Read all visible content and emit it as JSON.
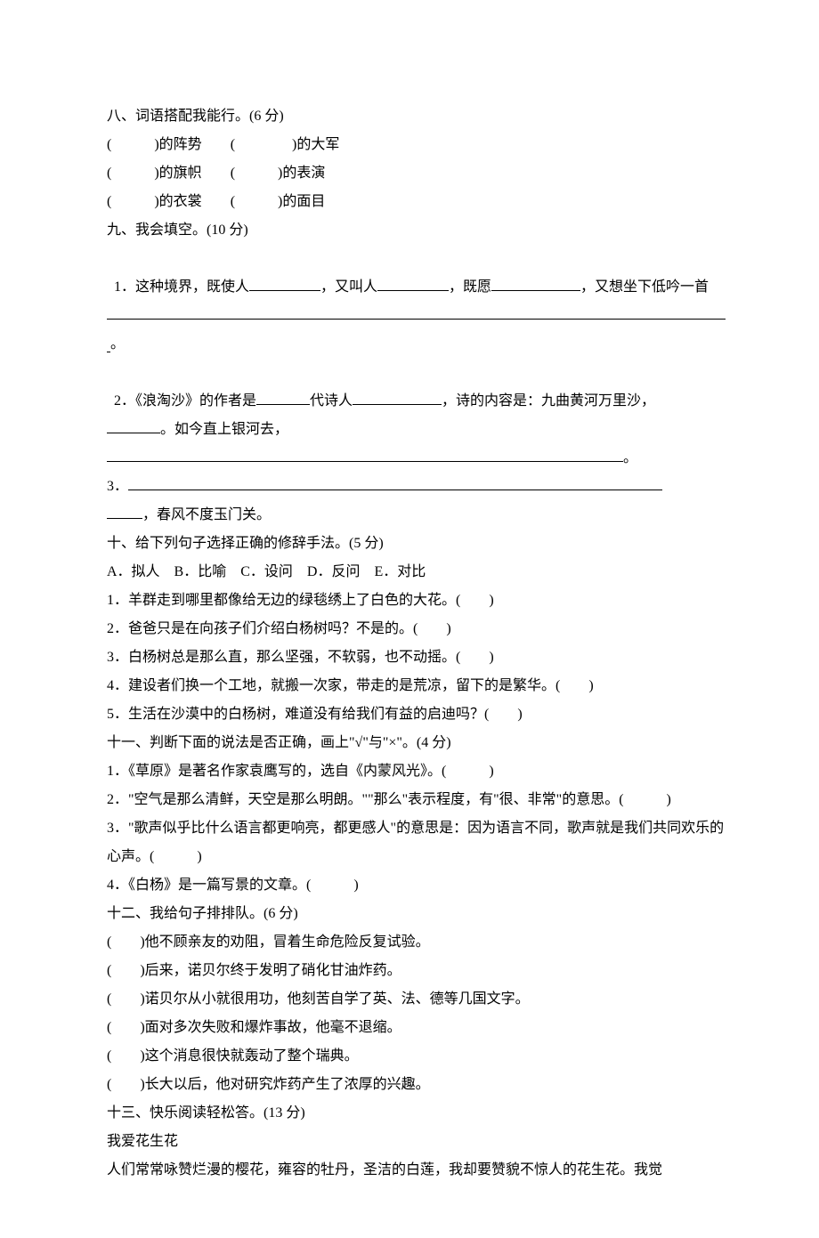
{
  "q8": {
    "title": "八、词语搭配我能行。(6 分)",
    "rows": [
      {
        "a": "(　　　)的阵势",
        "b": "(　　　　)的大军"
      },
      {
        "a": "(　　　)的旗帜",
        "b": "(　　　)的表演"
      },
      {
        "a": "(　　　)的衣裳",
        "b": "(　　　)的面目"
      }
    ]
  },
  "q9": {
    "title": "九、我会填空。(10 分)",
    "item1_a": "1．这种境界，既使人",
    "item1_b": "，又叫人",
    "item1_c": "，既愿",
    "item1_d": "，又想坐下低吟一首",
    "item1_end": "。",
    "item2_a": "2．《浪淘沙》的作者是",
    "item2_b": "代诗人",
    "item2_c": "，诗的内容是：九曲黄河万里沙，",
    "item2_d": "。如今直上银河去，",
    "item2_end": "。",
    "item3_a": "3．",
    "item3_b": "，春风不度玉门关。"
  },
  "q10": {
    "title": "十、给下列句子选择正确的修辞手法。(5 分)",
    "options": "A．拟人　B．比喻　C．设问　D．反问　E．对比",
    "items": [
      "1．羊群走到哪里都像给无边的绿毯绣上了白色的大花。(　　)",
      "2．爸爸只是在向孩子们介绍白杨树吗？不是的。(　　)",
      "3．白杨树总是那么直，那么坚强，不软弱，也不动摇。(　　)",
      "4．建设者们换一个工地，就搬一次家，带走的是荒凉，留下的是繁华。(　　)",
      "5．生活在沙漠中的白杨树，难道没有给我们有益的启迪吗？(　　)"
    ]
  },
  "q11": {
    "title": "十一、判断下面的说法是否正确，画上\"√\"与\"×\"。(4 分)",
    "items": [
      "1．《草原》是著名作家袁鹰写的，选自《内蒙风光》。(　　　)",
      "2．\"空气是那么清鲜，天空是那么明朗。\"\"那么\"表示程度，有\"很、非常\"的意思。(　　　)",
      "3．\"歌声似乎比什么语言都更响亮，都更感人\"的意思是：因为语言不同，歌声就是我们共同欢乐的心声。(　　　)",
      "4．《白杨》是一篇写景的文章。(　　　)"
    ]
  },
  "q12": {
    "title": "十二、我给句子排排队。(6 分)",
    "items": [
      "(　　)他不顾亲友的劝阻，冒着生命危险反复试验。",
      "(　　)后来，诺贝尔终于发明了硝化甘油炸药。",
      "(　　)诺贝尔从小就很用功，他刻苦自学了英、法、德等几国文字。",
      "(　　)面对多次失败和爆炸事故，他毫不退缩。",
      "(　　)这个消息很快就轰动了整个瑞典。",
      "(　　)长大以后，他对研究炸药产生了浓厚的兴趣。"
    ]
  },
  "q13": {
    "title": "十三、快乐阅读轻松答。(13 分)",
    "subtitle": "我爱花生花",
    "para": "人们常常咏赞烂漫的樱花，雍容的牡丹，圣洁的白莲，我却要赞貌不惊人的花生花。我觉"
  }
}
